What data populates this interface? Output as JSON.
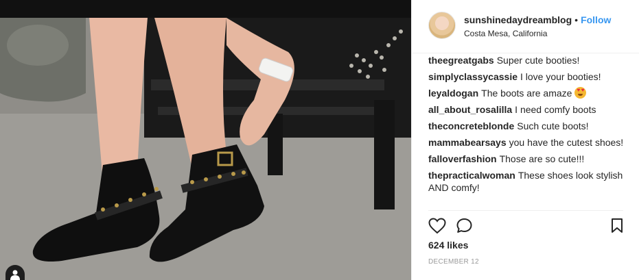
{
  "post": {
    "photo_alt": "Black studded ankle boots",
    "author": {
      "username": "sunshinedaydreamblog",
      "separator": "•",
      "follow_label": "Follow",
      "location": "Costa Mesa, California"
    },
    "comments": [
      {
        "user": "theegreatgabs",
        "text": "Super cute booties!"
      },
      {
        "user": "simplyclassycassie",
        "text": "I love your booties!"
      },
      {
        "user": "leyaldogan",
        "text": "The boots are amaze",
        "emoji": "heart-eyes-emoji"
      },
      {
        "user": "all_about_rosalilla",
        "text": "I need comfy boots"
      },
      {
        "user": "theconcreteblonde",
        "text": "Such cute boots!"
      },
      {
        "user": "mammabearsays",
        "text": "you have the cutest shoes!"
      },
      {
        "user": "falloverfashion",
        "text": "Those are so cute!!!"
      },
      {
        "user": "thepracticalwoman",
        "text": "These shoes look stylish AND comfy!"
      }
    ],
    "likes": "624 likes",
    "date": "DECEMBER 12",
    "icons": {
      "like": "heart-icon",
      "comment": "comment-bubble-icon",
      "save": "bookmark-icon",
      "corner": "user-silhouette-icon"
    },
    "colors": {
      "follow": "#3897f0",
      "text": "#262626",
      "muted": "#999999",
      "divider": "#efefef"
    }
  }
}
